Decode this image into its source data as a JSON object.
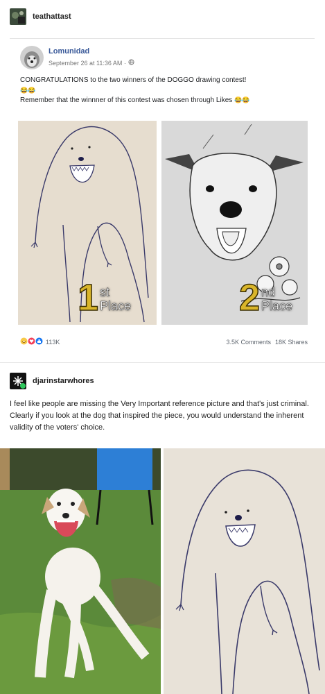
{
  "post1": {
    "username": "teathattast",
    "fb": {
      "page_name": "Lomunidad",
      "date": "September 26 at 11:36 AM ·",
      "line1": "CONGRATULATIONS to the two winners of the DOGGO drawing contest!",
      "emoji1": "😂😂",
      "line2": "Remember that the winnner of this contest was chosen through Likes",
      "emoji2": "😂😂",
      "first": {
        "num": "1",
        "sup": "st",
        "label": "Place"
      },
      "second": {
        "num": "2",
        "sup": "nd",
        "label": "Place"
      },
      "reactions_count": "113K",
      "comments": "3.5K Comments",
      "shares": "18K Shares"
    }
  },
  "post2": {
    "username": "djarinstarwhores",
    "text": "I feel like people are missing the Very Important reference picture and that's just criminal. Clearly if you look at the dog that inspired the piece, you would understand the inherent validity of the voters' choice."
  },
  "colors": {
    "fb_blue": "#385898",
    "gold": "#d9b52a",
    "grass": "#4d7a2e",
    "chair": "#2d7fd6"
  }
}
